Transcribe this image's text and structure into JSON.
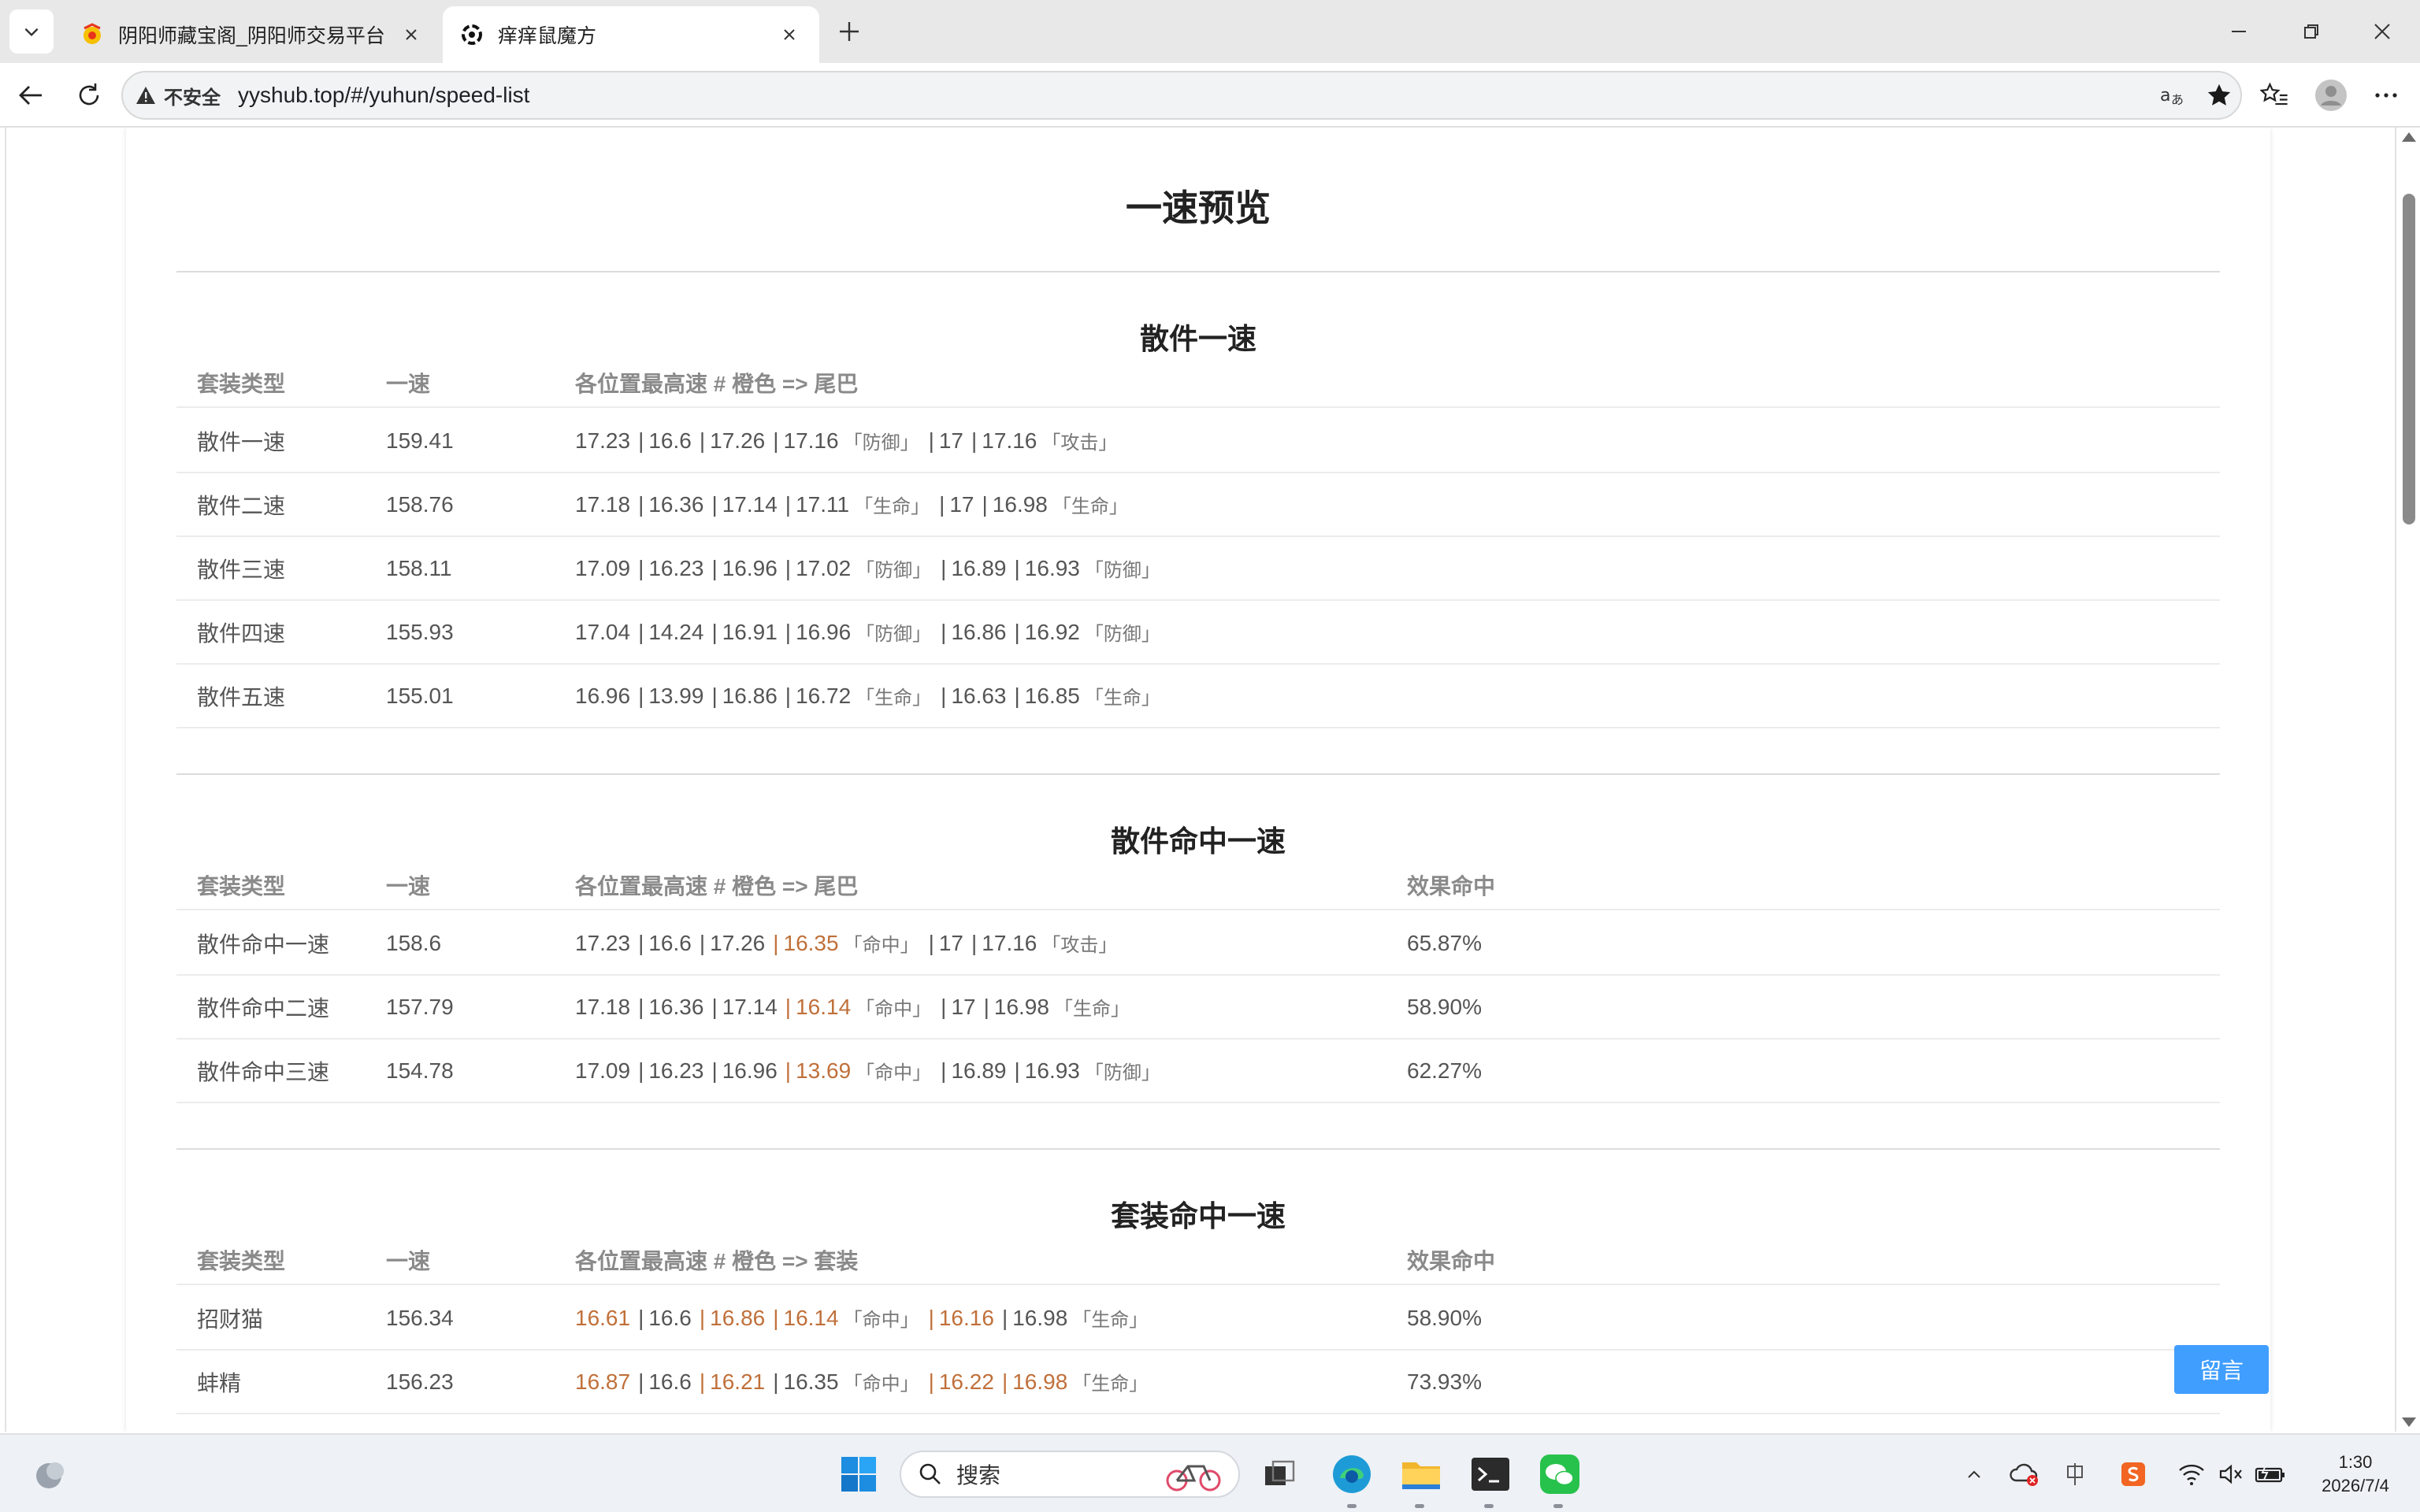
{
  "browser": {
    "tabs": [
      {
        "title": "阴阳师藏宝阁_阴阳师交易平台",
        "active": false
      },
      {
        "title": "痒痒鼠魔方",
        "active": true
      }
    ],
    "security_label": "不安全",
    "url": "yyshub.top/#/yuhun/speed-list"
  },
  "page": {
    "title": "一速预览",
    "sections": [
      {
        "title": "散件一速",
        "headers": [
          "套装类型",
          "一速",
          "各位置最高速 # 橙色 => 尾巴"
        ],
        "rows": [
          {
            "name": "散件一速",
            "speed": "159.41",
            "slots": [
              {
                "v": "17.23"
              },
              {
                "v": "16.6"
              },
              {
                "v": "17.26"
              },
              {
                "v": "17.16",
                "tag": "「防御」"
              },
              {
                "v": "17"
              },
              {
                "v": "17.16",
                "tag": "「攻击」"
              }
            ]
          },
          {
            "name": "散件二速",
            "speed": "158.76",
            "slots": [
              {
                "v": "17.18"
              },
              {
                "v": "16.36"
              },
              {
                "v": "17.14"
              },
              {
                "v": "17.11",
                "tag": "「生命」"
              },
              {
                "v": "17"
              },
              {
                "v": "16.98",
                "tag": "「生命」"
              }
            ]
          },
          {
            "name": "散件三速",
            "speed": "158.11",
            "slots": [
              {
                "v": "17.09"
              },
              {
                "v": "16.23"
              },
              {
                "v": "16.96"
              },
              {
                "v": "17.02",
                "tag": "「防御」"
              },
              {
                "v": "16.89"
              },
              {
                "v": "16.93",
                "tag": "「防御」"
              }
            ]
          },
          {
            "name": "散件四速",
            "speed": "155.93",
            "slots": [
              {
                "v": "17.04"
              },
              {
                "v": "14.24"
              },
              {
                "v": "16.91"
              },
              {
                "v": "16.96",
                "tag": "「防御」"
              },
              {
                "v": "16.86"
              },
              {
                "v": "16.92",
                "tag": "「防御」"
              }
            ]
          },
          {
            "name": "散件五速",
            "speed": "155.01",
            "slots": [
              {
                "v": "16.96"
              },
              {
                "v": "13.99"
              },
              {
                "v": "16.86"
              },
              {
                "v": "16.72",
                "tag": "「生命」"
              },
              {
                "v": "16.63"
              },
              {
                "v": "16.85",
                "tag": "「生命」"
              }
            ]
          }
        ]
      },
      {
        "title": "散件命中一速",
        "headers": [
          "套装类型",
          "一速",
          "各位置最高速 # 橙色 => 尾巴",
          "效果命中"
        ],
        "rows": [
          {
            "name": "散件命中一速",
            "speed": "158.6",
            "hit": "65.87%",
            "slots": [
              {
                "v": "17.23"
              },
              {
                "v": "16.6"
              },
              {
                "v": "17.26"
              },
              {
                "v": "16.35",
                "hl": true,
                "tag": "「命中」"
              },
              {
                "v": "17"
              },
              {
                "v": "17.16",
                "tag": "「攻击」"
              }
            ]
          },
          {
            "name": "散件命中二速",
            "speed": "157.79",
            "hit": "58.90%",
            "slots": [
              {
                "v": "17.18"
              },
              {
                "v": "16.36"
              },
              {
                "v": "17.14"
              },
              {
                "v": "16.14",
                "hl": true,
                "tag": "「命中」"
              },
              {
                "v": "17"
              },
              {
                "v": "16.98",
                "tag": "「生命」"
              }
            ]
          },
          {
            "name": "散件命中三速",
            "speed": "154.78",
            "hit": "62.27%",
            "slots": [
              {
                "v": "17.09"
              },
              {
                "v": "16.23"
              },
              {
                "v": "16.96"
              },
              {
                "v": "13.69",
                "hl": true,
                "tag": "「命中」"
              },
              {
                "v": "16.89"
              },
              {
                "v": "16.93",
                "tag": "「防御」"
              }
            ]
          }
        ]
      },
      {
        "title": "套装命中一速",
        "headers": [
          "套装类型",
          "一速",
          "各位置最高速 # 橙色 => 套装",
          "效果命中"
        ],
        "rows": [
          {
            "name": "招财猫",
            "speed": "156.34",
            "hit": "58.90%",
            "slots": [
              {
                "v": "16.61",
                "hl": true
              },
              {
                "v": "16.6"
              },
              {
                "v": "16.86",
                "hl": true
              },
              {
                "v": "16.14",
                "hl": true,
                "tag": "「命中」"
              },
              {
                "v": "16.16",
                "hl": true
              },
              {
                "v": "16.98",
                "tag": "「生命」"
              }
            ]
          },
          {
            "name": "蚌精",
            "speed": "156.23",
            "hit": "73.93%",
            "slots": [
              {
                "v": "16.87",
                "hl": true
              },
              {
                "v": "16.6"
              },
              {
                "v": "16.21",
                "hl": true
              },
              {
                "v": "16.35",
                "tag": "「命中」"
              },
              {
                "v": "16.22",
                "hl": true
              },
              {
                "v": "16.98",
                "hl": true,
                "tag": "「生命」"
              }
            ]
          }
        ]
      }
    ],
    "message_button": "留言"
  },
  "taskbar": {
    "search_label": "搜索",
    "time": "1:30",
    "date": "2026/7/4"
  },
  "colors": {
    "highlight": "#c0703a",
    "accent_button": "#409eff"
  }
}
